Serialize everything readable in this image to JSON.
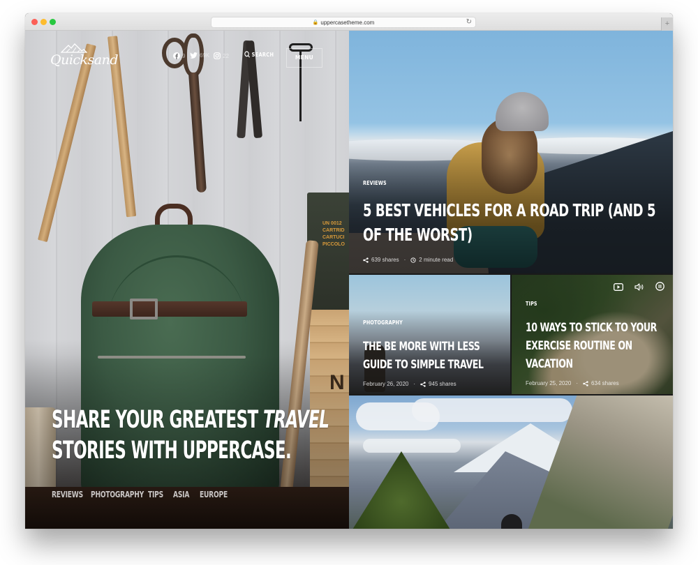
{
  "browser": {
    "url": "uppercasetheme.com",
    "lock_icon": "lock-icon",
    "reload_icon": "reload-icon",
    "new_tab_label": "+"
  },
  "header": {
    "logo_text": "Quicksand",
    "social": [
      {
        "network": "facebook",
        "icon": "facebook-icon",
        "count": "9"
      },
      {
        "network": "twitter",
        "icon": "twitter-icon",
        "count": "69K"
      },
      {
        "network": "instagram",
        "icon": "instagram-icon",
        "count": "22"
      }
    ],
    "search_label": "SEARCH",
    "menu_label": "MENU"
  },
  "hero": {
    "headline_part1": "SHARE YOUR GREATEST ",
    "headline_emphasis": "TRAVEL",
    "headline_part2": "STORIES WITH UPPERCASE.",
    "ammo_text": [
      "UN 0012",
      "CARTRID",
      "CARTUCI",
      "PICCOLO"
    ],
    "crate_letter": "N",
    "categories": [
      "REVIEWS",
      "PHOTOGRAPHY",
      "TIPS",
      "ASIA",
      "EUROPE"
    ]
  },
  "posts": [
    {
      "category": "REVIEWS",
      "title": "5 BEST VEHICLES FOR A ROAD TRIP (AND 5 OF THE WORST)",
      "shares": "639 shares",
      "read_time": "2 minute read"
    },
    {
      "category": "PHOTOGRAPHY",
      "title": "THE BE MORE WITH LESS GUIDE TO SIMPLE TRAVEL",
      "date": "February 26, 2020",
      "shares": "945 shares"
    },
    {
      "category": "TIPS",
      "title": "10 WAYS TO STICK TO YOUR EXERCISE ROUTINE ON VACATION",
      "date": "February 25, 2020",
      "shares": "634 shares",
      "media_controls": [
        "youtube-icon",
        "volume-icon",
        "pause-icon"
      ]
    }
  ],
  "meta_separator": "·"
}
